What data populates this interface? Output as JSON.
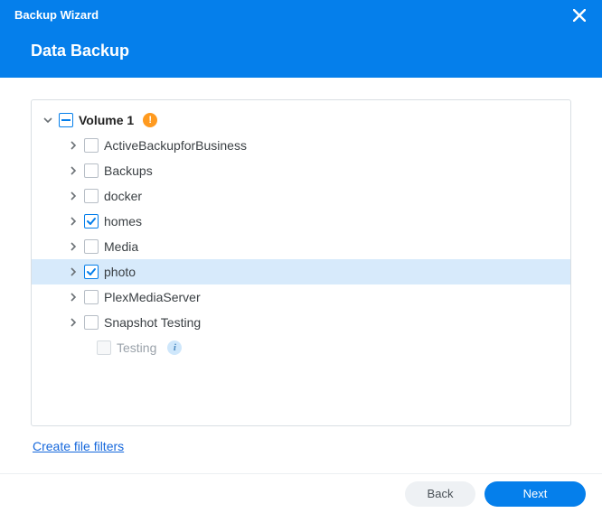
{
  "header": {
    "title": "Backup Wizard",
    "subtitle": "Data Backup"
  },
  "tree": {
    "root": {
      "label": "Volume 1",
      "warn": "!"
    },
    "items": [
      {
        "label": "ActiveBackupforBusiness",
        "checked": false
      },
      {
        "label": "Backups",
        "checked": false
      },
      {
        "label": "docker",
        "checked": false
      },
      {
        "label": "homes",
        "checked": true
      },
      {
        "label": "Media",
        "checked": false
      },
      {
        "label": "photo",
        "checked": true,
        "selected": true
      },
      {
        "label": "PlexMediaServer",
        "checked": false
      },
      {
        "label": "Snapshot Testing",
        "checked": false
      }
    ],
    "disabled_item": {
      "label": "Testing",
      "info": "i"
    }
  },
  "links": {
    "filters": "Create file filters"
  },
  "footer": {
    "back": "Back",
    "next": "Next"
  }
}
